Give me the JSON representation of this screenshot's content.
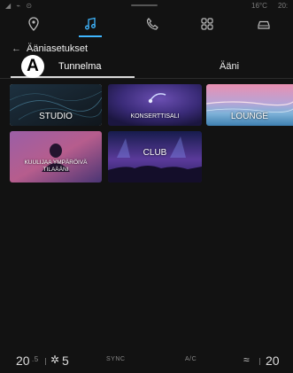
{
  "status": {
    "temperature": "16°C",
    "time": "20:"
  },
  "header": {
    "title": "Ääniasetukset"
  },
  "badge": {
    "letter": "A"
  },
  "tabs": [
    {
      "label": "Tunnelma"
    },
    {
      "label": "Ääni"
    }
  ],
  "cards": [
    {
      "label": "STUDIO"
    },
    {
      "label": "KONSERTTISALI"
    },
    {
      "label": "LOUNGE"
    },
    {
      "label": "KUULIJAA YMPÄRÖIVÄ TILAÄÄNI"
    },
    {
      "label": "CLUB"
    }
  ],
  "climate": {
    "left_temp": "20",
    "fan_speed": "5",
    "sync": "SYNC",
    "ac": "A/C",
    "right_temp": "20"
  },
  "colors": {
    "accent": "#3fb6ff",
    "background": "#121212"
  }
}
